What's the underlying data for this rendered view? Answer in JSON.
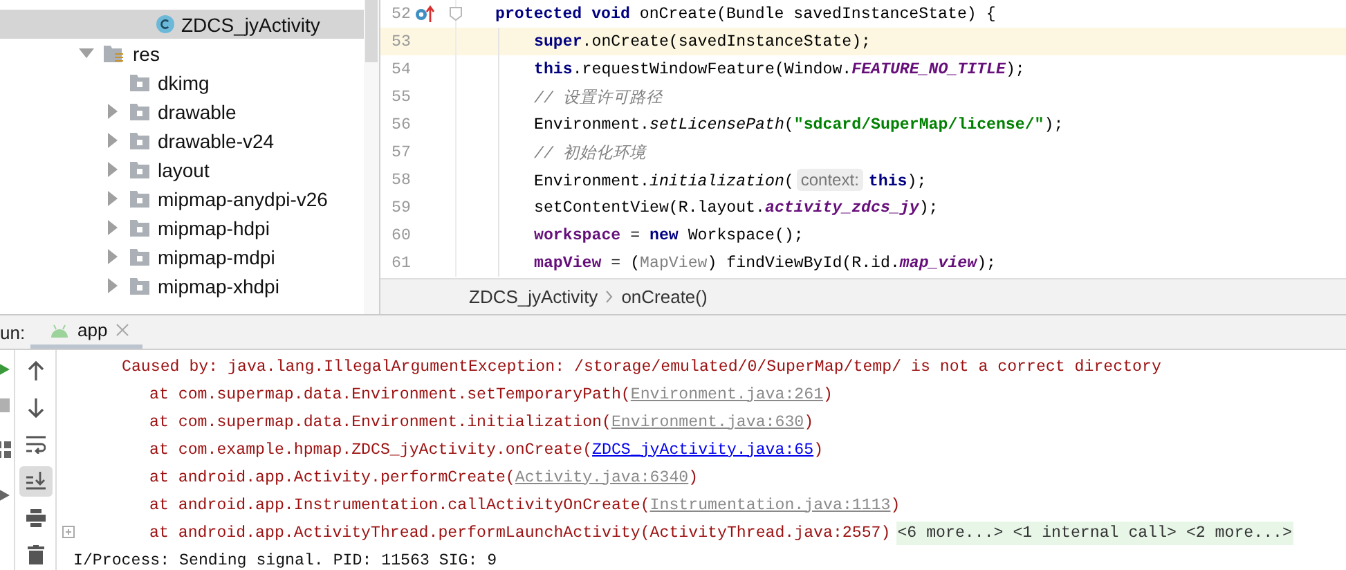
{
  "project_tree": {
    "items": [
      {
        "label": "ZDCS_jyActivity",
        "kind": "class",
        "selected": true
      },
      {
        "label": "res",
        "kind": "resources",
        "expanded": true,
        "selected": false,
        "children": [
          {
            "label": "dkimg",
            "kind": "folder",
            "selected": false
          },
          {
            "label": "drawable",
            "kind": "folder",
            "expanded": false,
            "selected": false
          },
          {
            "label": "drawable-v24",
            "kind": "folder",
            "expanded": false,
            "selected": false
          },
          {
            "label": "layout",
            "kind": "folder",
            "expanded": false,
            "selected": false
          },
          {
            "label": "mipmap-anydpi-v26",
            "kind": "folder",
            "expanded": false,
            "selected": false
          },
          {
            "label": "mipmap-hdpi",
            "kind": "folder",
            "expanded": false,
            "selected": false
          },
          {
            "label": "mipmap-mdpi",
            "kind": "folder",
            "expanded": false,
            "selected": false
          },
          {
            "label": "mipmap-xhdpi",
            "kind": "folder",
            "expanded": false,
            "selected": false
          }
        ]
      }
    ]
  },
  "editor": {
    "lines": [
      {
        "number": "52",
        "current": false,
        "override_marker": true,
        "tokens": [
          {
            "kind": "kw",
            "text": "protected void"
          },
          {
            "kind": "plain",
            "text": " onCreate(Bundle savedInstanceState) {"
          }
        ],
        "children": [
          {
            "number": "53",
            "current": true,
            "override_marker": false,
            "tokens": [
              {
                "kind": "kw",
                "text": "super"
              },
              {
                "kind": "plain",
                "text": ".onCreate(savedInstanceState);"
              }
            ]
          },
          {
            "number": "54",
            "current": false,
            "override_marker": false,
            "tokens": [
              {
                "kind": "kw",
                "text": "this"
              },
              {
                "kind": "plain",
                "text": ".requestWindowFeature(Window."
              },
              {
                "kind": "const",
                "text": "FEATURE_NO_TITLE"
              },
              {
                "kind": "plain",
                "text": ");"
              }
            ]
          },
          {
            "number": "55",
            "current": false,
            "override_marker": false,
            "tokens": [
              {
                "kind": "comment",
                "text": "// 设置许可路径"
              }
            ]
          },
          {
            "number": "56",
            "current": false,
            "override_marker": false,
            "tokens": [
              {
                "kind": "plain",
                "text": "Environment."
              },
              {
                "kind": "static_call",
                "text": "setLicensePath"
              },
              {
                "kind": "plain",
                "text": "("
              },
              {
                "kind": "str",
                "text": "\"sdcard/SuperMap/license/\""
              },
              {
                "kind": "plain",
                "text": ");"
              }
            ]
          },
          {
            "number": "57",
            "current": false,
            "override_marker": false,
            "tokens": [
              {
                "kind": "comment",
                "text": "// 初始化环境"
              }
            ]
          },
          {
            "number": "58",
            "current": false,
            "override_marker": false,
            "tokens": [
              {
                "kind": "plain",
                "text": "Environment."
              },
              {
                "kind": "static_call",
                "text": "initialization"
              },
              {
                "kind": "plain",
                "text": "("
              },
              {
                "kind": "hint",
                "text": "context:"
              },
              {
                "kind": "kw",
                "text": "this"
              },
              {
                "kind": "plain",
                "text": ");"
              }
            ]
          },
          {
            "number": "59",
            "current": false,
            "override_marker": false,
            "tokens": [
              {
                "kind": "plain",
                "text": "setContentView(R.layout."
              },
              {
                "kind": "const",
                "text": "activity_zdcs_jy"
              },
              {
                "kind": "plain",
                "text": ");"
              }
            ]
          },
          {
            "number": "60",
            "current": false,
            "override_marker": false,
            "tokens": [
              {
                "kind": "field",
                "text": "workspace"
              },
              {
                "kind": "plain",
                "text": " = "
              },
              {
                "kind": "kw",
                "text": "new"
              },
              {
                "kind": "plain",
                "text": " Workspace();"
              }
            ]
          },
          {
            "number": "61",
            "current": false,
            "override_marker": false,
            "tokens": [
              {
                "kind": "field",
                "text": "mapView"
              },
              {
                "kind": "plain",
                "text": " = ("
              },
              {
                "kind": "cast",
                "text": "MapView"
              },
              {
                "kind": "plain",
                "text": ") findViewById(R.id."
              },
              {
                "kind": "const",
                "text": "map_view"
              },
              {
                "kind": "plain",
                "text": ");"
              }
            ]
          }
        ]
      }
    ],
    "breadcrumbs": [
      "ZDCS_jyActivity",
      "onCreate()"
    ]
  },
  "run_panel": {
    "label": "un:",
    "tabs": [
      {
        "label": "app",
        "selected": true
      }
    ],
    "toolbar": [
      {
        "kind": "up",
        "selected": false
      },
      {
        "kind": "down",
        "selected": false
      },
      {
        "kind": "wrap",
        "selected": false
      },
      {
        "kind": "scroll_end",
        "selected": true
      },
      {
        "kind": "print",
        "selected": false
      },
      {
        "kind": "delete",
        "selected": false
      }
    ],
    "console": [
      {
        "kind": "cause",
        "foldable": false,
        "parts": [
          {
            "kind": "text",
            "text": "Caused by: java.lang.IllegalArgumentException: /storage/emulated/0/SuperMap/temp/ is not a correct directory"
          }
        ]
      },
      {
        "kind": "frame",
        "foldable": false,
        "parts": [
          {
            "kind": "text",
            "text": "at com.supermap.data.Environment.setTemporaryPath("
          },
          {
            "kind": "link",
            "text": "Environment.java:261"
          },
          {
            "kind": "text",
            "text": ")"
          }
        ]
      },
      {
        "kind": "frame",
        "foldable": false,
        "parts": [
          {
            "kind": "text",
            "text": "at com.supermap.data.Environment.initialization("
          },
          {
            "kind": "link",
            "text": "Environment.java:630"
          },
          {
            "kind": "text",
            "text": ")"
          }
        ]
      },
      {
        "kind": "frame",
        "foldable": false,
        "parts": [
          {
            "kind": "text",
            "text": "at com.example.hpmap.ZDCS_jyActivity.onCreate("
          },
          {
            "kind": "source_link",
            "text": "ZDCS_jyActivity.java:65"
          },
          {
            "kind": "text",
            "text": ")"
          }
        ]
      },
      {
        "kind": "frame",
        "foldable": false,
        "parts": [
          {
            "kind": "text",
            "text": "at android.app.Activity.performCreate("
          },
          {
            "kind": "link",
            "text": "Activity.java:6340"
          },
          {
            "kind": "text",
            "text": ")"
          }
        ]
      },
      {
        "kind": "frame",
        "foldable": false,
        "parts": [
          {
            "kind": "text",
            "text": "at android.app.Instrumentation.callActivityOnCreate("
          },
          {
            "kind": "link",
            "text": "Instrumentation.java:1113"
          },
          {
            "kind": "text",
            "text": ")"
          }
        ]
      },
      {
        "kind": "frame",
        "foldable": true,
        "parts": [
          {
            "kind": "text",
            "text": "at android.app.ActivityThread.performLaunchActivity(ActivityThread.java:2557)"
          },
          {
            "kind": "folded",
            "text": "<6 more...> <1 internal call> <2 more...>"
          }
        ]
      },
      {
        "kind": "log",
        "foldable": false,
        "parts": [
          {
            "kind": "text",
            "text": "I/Process: Sending signal. PID: 11563 SIG: 9"
          }
        ]
      }
    ]
  }
}
